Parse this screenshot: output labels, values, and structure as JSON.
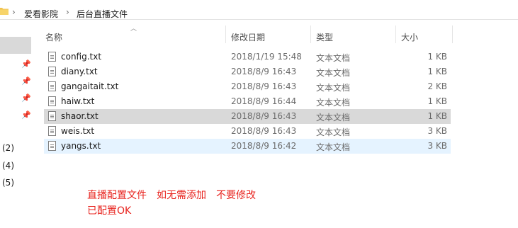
{
  "breadcrumb": {
    "parent": "爱看影院",
    "current": "后台直播文件",
    "separator": "›"
  },
  "columns": {
    "name": "名称",
    "modified": "修改日期",
    "type": "类型",
    "size": "大小"
  },
  "nav": {
    "items": [
      "(2)",
      "(4)",
      "(5)"
    ]
  },
  "files": [
    {
      "name": "config.txt",
      "modified": "2018/1/19 15:48",
      "type": "文本文档",
      "size": "1 KB"
    },
    {
      "name": "diany.txt",
      "modified": "2018/8/9 16:43",
      "type": "文本文档",
      "size": "1 KB"
    },
    {
      "name": "gangaitait.txt",
      "modified": "2018/8/9 16:43",
      "type": "文本文档",
      "size": "2 KB"
    },
    {
      "name": "haiw.txt",
      "modified": "2018/8/9 16:44",
      "type": "文本文档",
      "size": "1 KB"
    },
    {
      "name": "shaor.txt",
      "modified": "2018/8/9 16:43",
      "type": "文本文档",
      "size": "1 KB"
    },
    {
      "name": "weis.txt",
      "modified": "2018/8/9 16:43",
      "type": "文本文档",
      "size": "3 KB"
    },
    {
      "name": "yangs.txt",
      "modified": "2018/8/9 16:42",
      "type": "文本文档",
      "size": "3 KB"
    }
  ],
  "note": {
    "line1": "直播配置文件　如无需添加　不要修改",
    "line2": "已配置OK"
  },
  "colors": {
    "note": "#e8231e",
    "selected_row": "#d9d9d9",
    "hover_row": "#e5f3ff"
  }
}
